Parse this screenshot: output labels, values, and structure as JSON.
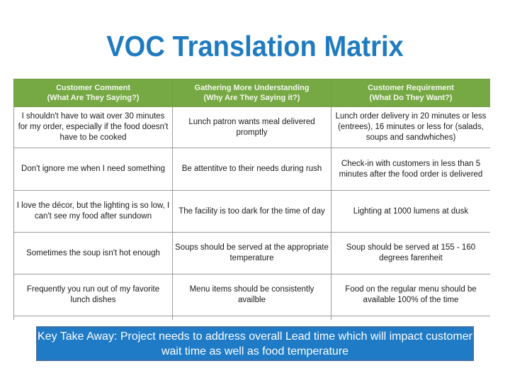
{
  "slide": {
    "title": "VOC Translation Matrix"
  },
  "matrix": {
    "headers": [
      {
        "line1": "Customer Comment",
        "line2": "(What Are They Saying?)"
      },
      {
        "line1": "Gathering More Understanding",
        "line2": "(Why Are They Saying it?)"
      },
      {
        "line1": "Customer Requirement",
        "line2": "(What Do They Want?)"
      }
    ],
    "rows": [
      {
        "comment": "I shouldn't have to wait over 30 minutes for my order, especially if the food doesn't have to be cooked",
        "understanding": "Lunch patron wants meal delivered promptly",
        "requirement": "Lunch order delivery in 20 minutes or less (entrees), 16 minutes or less for (salads, soups and sandwhiches)"
      },
      {
        "comment": "Don't ignore me when I need something",
        "understanding": "Be attentitve to their needs during rush",
        "requirement": "Check-in with customers in less than 5 minutes after the food order is delivered"
      },
      {
        "comment": "I love the décor, but the lighting is so low, I can't see my food after sundown",
        "understanding": "The facility is too dark for the time of day",
        "requirement": "Lighting at 1000 lumens at dusk"
      },
      {
        "comment": "Sometimes the soup isn't hot enough",
        "understanding": "Soups should be served at the appropriate temperature",
        "requirement": "Soup should be served at 155 - 160 degrees farenheit"
      },
      {
        "comment": "Frequently you run out of my favorite lunch dishes",
        "understanding": "Menu items should be consistently availble",
        "requirement": "Food  on the regular menu should be available 100% of the time"
      }
    ]
  },
  "takeaway": {
    "text": "Key Take Away: Project needs to address overall Lead time which will impact customer wait time as well as food temperature"
  },
  "colors": {
    "title": "#1f7bc0",
    "header_bg": "#76a844",
    "takeaway_bg": "#1f7bc6",
    "takeaway_border": "#3f6fa6"
  }
}
